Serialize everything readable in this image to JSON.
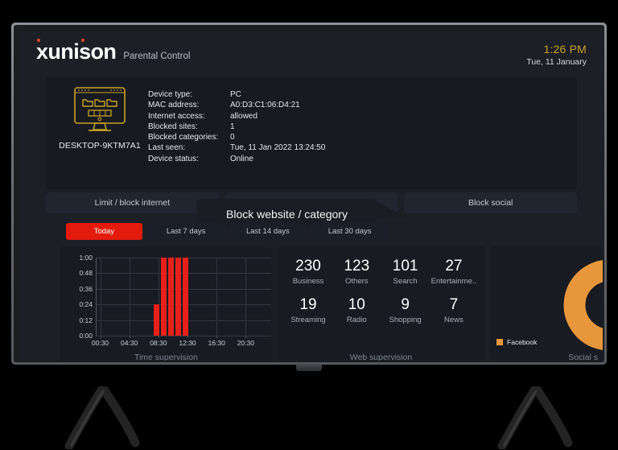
{
  "header": {
    "logo_text": "xunison",
    "app_subtitle": "Parental Control",
    "time": "1:26 PM",
    "date": "Tue, 11 January",
    "time_color": "#c9a227"
  },
  "device": {
    "icon": "desktop-monitor-icon",
    "name": "DESKTOP-9KTM7A1",
    "specs": [
      {
        "key": "Device type:",
        "value": "PC"
      },
      {
        "key": "MAC address:",
        "value": "A0:D3:C1:06:D4:21"
      },
      {
        "key": "Internet access:",
        "value": "allowed"
      },
      {
        "key": "Blocked sites:",
        "value": "1"
      },
      {
        "key": "Blocked categories:",
        "value": "0"
      },
      {
        "key": "Last seen:",
        "value": "Tue, 11 Jan 2022 13:24:50"
      },
      {
        "key": "Device status:",
        "value": "Online"
      }
    ]
  },
  "tabs": [
    {
      "label": "Limit / block internet",
      "active": false
    },
    {
      "label": "Block website / category",
      "active": false
    },
    {
      "label": "Block social",
      "active": false
    }
  ],
  "tooltip": {
    "text": "Block website / category"
  },
  "ranges": [
    {
      "label": "Today",
      "active": true
    },
    {
      "label": "Last 7 days",
      "active": false
    },
    {
      "label": "Last 14 days",
      "active": false
    },
    {
      "label": "Last 30 days",
      "active": false
    }
  ],
  "panels": {
    "time_caption": "Time supervision",
    "web_caption": "Web supervision",
    "social_caption": "Social s"
  },
  "web_stats": [
    {
      "value": "230",
      "label": "Business"
    },
    {
      "value": "123",
      "label": "Others"
    },
    {
      "value": "101",
      "label": "Search"
    },
    {
      "value": "27",
      "label": "Entertainme.."
    },
    {
      "value": "19",
      "label": "Streaming"
    },
    {
      "value": "10",
      "label": "Radio"
    },
    {
      "value": "9",
      "label": "Shopping"
    },
    {
      "value": "7",
      "label": "News"
    }
  ],
  "social_legend": [
    {
      "label": "Facebook",
      "color": "#e8963c"
    }
  ],
  "chart_data": [
    {
      "type": "bar",
      "title": "Time supervision",
      "xlabel": "Time supervision",
      "ylabel": "",
      "categories": [
        "08:15",
        "09:15",
        "10:15",
        "11:15",
        "12:15"
      ],
      "values": [
        24,
        60,
        60,
        60,
        60
      ],
      "value_unit": "minutes",
      "yticks": [
        "0:00",
        "0:12",
        "0:24",
        "0:36",
        "0:48",
        "1:00"
      ],
      "ytick_values": [
        0,
        12,
        24,
        36,
        48,
        60
      ],
      "ylim": [
        0,
        60
      ],
      "xticks": [
        "00:30",
        "04:30",
        "08:30",
        "12:30",
        "16:30",
        "20:30"
      ],
      "xtick_hours": [
        0.5,
        4.5,
        8.5,
        12.5,
        16.5,
        20.5
      ],
      "xlim_hours": [
        0,
        24
      ],
      "grid": true,
      "legend": "none",
      "bar_color": "#e8201a"
    },
    {
      "type": "pie",
      "title": "Social s",
      "labels": [
        "Facebook"
      ],
      "values": [
        100
      ],
      "colors": [
        "#e8963c"
      ],
      "donut": true,
      "legend": "bottom-left"
    }
  ]
}
